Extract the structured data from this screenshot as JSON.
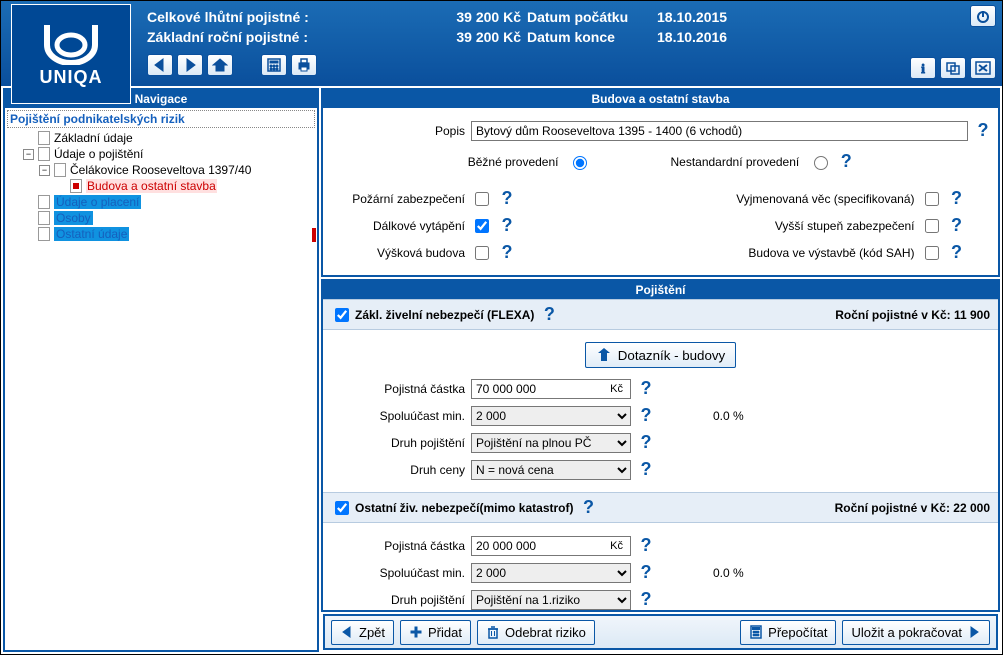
{
  "header": {
    "line1_label": "Celkové lhůtní pojistné :",
    "line1_value": "39 200 Kč",
    "line1_label2": "Datum počátku",
    "line1_value2": "18.10.2015",
    "line2_label": "Základní roční pojistné :",
    "line2_value": "39 200 Kč",
    "line2_label2": "Datum konce",
    "line2_value2": "18.10.2016",
    "logo_name": "UNIQA"
  },
  "nav": {
    "title": "Navigace",
    "root": "Pojištění podnikatelských rizik",
    "items": {
      "zakladni": "Základní údaje",
      "udaje_poj": "Údaje o pojištění",
      "celak": "Čelákovice Rooseveltova 1397/40",
      "budova": "Budova a ostatní stavba",
      "placeni": "Údaje o placení",
      "osoby": "Osoby",
      "ostatni": "Ostatní údaje"
    }
  },
  "building": {
    "panel_title": "Budova a ostatní stavba",
    "popis_label": "Popis",
    "popis_value": "Bytový dům Rooseveltova 1395 - 1400 (6 vchodů)",
    "bezne": "Běžné provedení",
    "nestd": "Nestandardní provedení",
    "pozarni": "Požární zabezpečení",
    "dalkove": "Dálkové vytápění",
    "vyskova": "Výšková budova",
    "vyjmen": "Vyjmenovaná věc (specifikovaná)",
    "vyssi": "Vyšší stupeň zabezpečení",
    "vystavba": "Budova ve výstavbě (kód SAH)"
  },
  "poj": {
    "panel_title": "Pojištění",
    "flexa_label": "Zákl. živelní nebezpečí (FLEXA)",
    "flexa_right": "Roční pojistné v Kč: 11 900",
    "dotaznik": "Dotazník - budovy",
    "pc_label": "Pojistná částka",
    "pc_value1": "70 000 000",
    "unit": "Kč",
    "spolu_label": "Spoluúčast min.",
    "spolu_value": "2 000",
    "pct": "0.0 %",
    "druh_poj_label": "Druh pojištění",
    "druh_poj_value": "Pojištění na plnou PČ",
    "druh_ceny_label": "Druh ceny",
    "druh_ceny_value": "N = nová cena",
    "ost_label": "Ostatní živ. nebezpečí(mimo katastrof)",
    "ost_right": "Roční pojistné v Kč: 22 000",
    "pc_value2": "20 000 000",
    "druh_poj_value2": "Pojištění na 1.riziko"
  },
  "footer": {
    "back": "Zpět",
    "add": "Přidat",
    "remove": "Odebrat riziko",
    "recalc": "Přepočítat",
    "save": "Uložit a pokračovat"
  }
}
